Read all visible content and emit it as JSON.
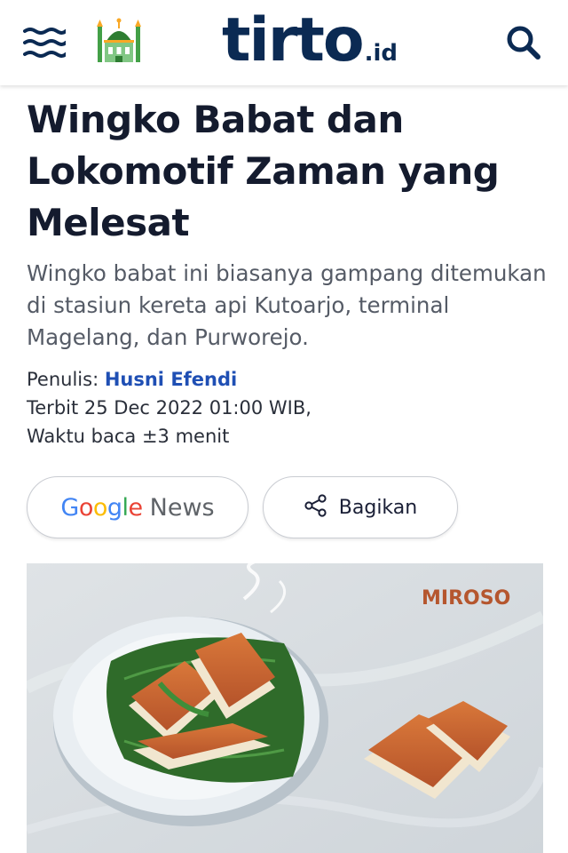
{
  "header": {
    "logo_main": "tirto",
    "logo_suffix": ".id",
    "icons": [
      "hamburger-menu-icon",
      "mosque-icon",
      "search-icon"
    ],
    "brand_color": "#0b2a53"
  },
  "article": {
    "title": "Wingko Babat dan Lokomotif Zaman yang Melesat",
    "subtitle": "Wingko babat ini biasanya gampang ditemukan di stasiun kereta api Kutoarjo, terminal Magelang, dan Purworejo.",
    "author_label": "Penulis:",
    "author_name": "Husni Efendi",
    "published": "Terbit 25 Dec 2022 01:00 WIB,",
    "read_time": "Waktu baca ±3 menit"
  },
  "actions": {
    "google_word": "Google",
    "google_news": "News",
    "share_label": "Bagikan"
  },
  "image": {
    "watermark": "MIROSO"
  }
}
